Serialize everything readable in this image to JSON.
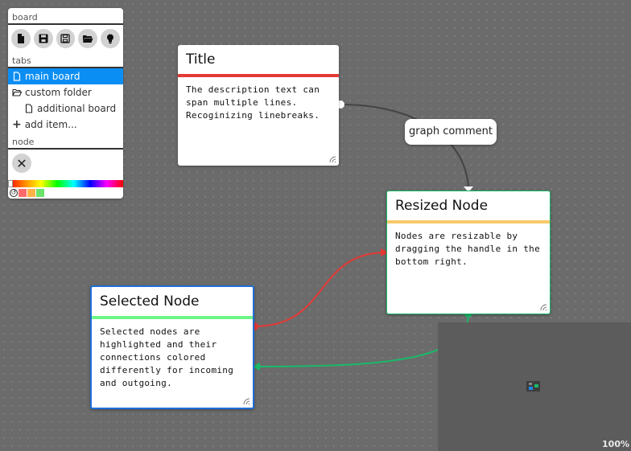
{
  "panel": {
    "board_header": "board",
    "tabs_header": "tabs",
    "node_header": "node",
    "toolbar": [
      {
        "icon": "new-file-icon"
      },
      {
        "icon": "save-icon"
      },
      {
        "icon": "save-as-icon"
      },
      {
        "icon": "open-folder-icon"
      },
      {
        "icon": "lightbulb-icon"
      }
    ],
    "tabs": [
      {
        "label": "main board",
        "icon": "file-icon",
        "selected": true
      },
      {
        "label": "custom folder",
        "icon": "folder-open-icon"
      },
      {
        "label": "additional board",
        "icon": "file-icon"
      },
      {
        "label": "add item...",
        "icon": "plus-icon"
      }
    ],
    "swatch_colors": [
      "#ff6b6b",
      "#ffb347",
      "#6be36b"
    ]
  },
  "nodes": [
    {
      "id": "title",
      "title": "Title",
      "color": "#e53935",
      "description": "The description text can\nspan multiple lines.\nRecoginizing linebreaks."
    },
    {
      "id": "resized",
      "title": "Resized Node",
      "color": "#f7c96b",
      "description": "Nodes are resizable by\ndragging the handle in the\nbottom right."
    },
    {
      "id": "selected",
      "title": "Selected Node",
      "color": "#6ef58a",
      "description": "Selected nodes are\nhighlighted and their\nconnections colored\ndifferently for incoming\nand outgoing."
    }
  ],
  "comment": "graph comment",
  "connections": {
    "default_color": "#444444",
    "incoming_color": "#e53935",
    "outgoing_color": "#1ab86a"
  },
  "zoom_level": "100%"
}
